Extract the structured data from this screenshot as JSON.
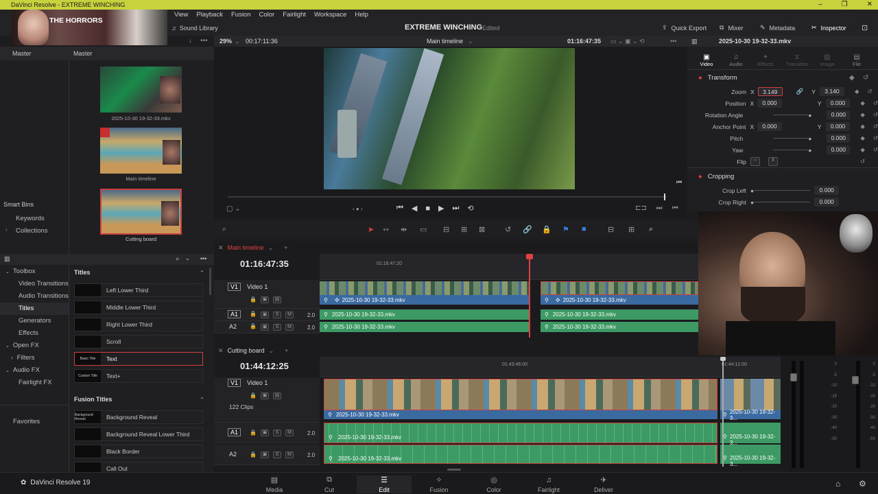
{
  "window": {
    "title": "DaVinci Resolve - EXTREME WINCHING"
  },
  "menu": {
    "items": [
      "View",
      "Playback",
      "Fusion",
      "Color",
      "Fairlight",
      "Workspace",
      "Help"
    ]
  },
  "webcam_overlay": {
    "title": "THE HORRORS"
  },
  "toolbar": {
    "sound_library": "Sound Library",
    "project_name": "EXTREME WINCHING",
    "edit_status": "Edited",
    "quick_export": "Quick Export",
    "mixer": "Mixer",
    "metadata": "Metadata",
    "inspector": "Inspector"
  },
  "media_pool": {
    "header_left": "Master",
    "header_right": "Master",
    "clips": [
      {
        "label": "2025-10-30 19-32-33.mkv"
      },
      {
        "label": "Main timeline"
      },
      {
        "label": "Cutting board"
      }
    ],
    "smart_bins": "Smart Bins",
    "bins": [
      "Keywords",
      "Collections"
    ]
  },
  "viewer": {
    "zoom": "29%",
    "duration": "00:17:11:36",
    "timeline_name": "Main timeline",
    "timecode": "01:16:47:35",
    "clip_name": "2025-10-30 19-32-33.mkv"
  },
  "effects": {
    "toolbox_items": [
      {
        "label": "Toolbox",
        "level": 0
      },
      {
        "label": "Video Transitions",
        "level": 1
      },
      {
        "label": "Audio Transitions",
        "level": 1
      },
      {
        "label": "Titles",
        "level": 1,
        "active": true
      },
      {
        "label": "Generators",
        "level": 1
      },
      {
        "label": "Effects",
        "level": 1
      },
      {
        "label": "Open FX",
        "level": 0
      },
      {
        "label": "Filters",
        "level": 1
      },
      {
        "label": "Audio FX",
        "level": 0
      },
      {
        "label": "Fairlight FX",
        "level": 1
      }
    ],
    "favorites": "Favorites",
    "titles_header": "Titles",
    "titles": [
      {
        "thumb": "",
        "name": "Left Lower Third"
      },
      {
        "thumb": "",
        "name": "Middle Lower Third"
      },
      {
        "thumb": "",
        "name": "Right Lower Third"
      },
      {
        "thumb": "",
        "name": "Scroll"
      },
      {
        "thumb": "Basic Title",
        "name": "Text"
      },
      {
        "thumb": "Custom Title",
        "name": "Text+"
      }
    ],
    "fusion_header": "Fusion Titles",
    "fusion_titles": [
      {
        "thumb": "Background Reveal",
        "name": "Background Reveal"
      },
      {
        "thumb": "",
        "name": "Background Reveal Lower Third"
      },
      {
        "thumb": "",
        "name": "Black Border"
      },
      {
        "thumb": "",
        "name": "Call Out"
      }
    ]
  },
  "inspector": {
    "tabs": [
      "Video",
      "Audio",
      "Effects",
      "Transition",
      "Image",
      "File"
    ],
    "transform_label": "Transform",
    "zoom": {
      "label": "Zoom",
      "x": "3.149",
      "y": "3.140"
    },
    "position": {
      "label": "Position",
      "x": "0.000",
      "y": "0.000"
    },
    "rotation": {
      "label": "Rotation Angle",
      "value": "0.000"
    },
    "anchor": {
      "label": "Anchor Point",
      "x": "0.000",
      "y": "0.000"
    },
    "pitch": {
      "label": "Pitch",
      "value": "0.000"
    },
    "yaw": {
      "label": "Yaw",
      "value": "0.000"
    },
    "flip": {
      "label": "Flip"
    },
    "cropping_label": "Cropping",
    "crop_left": {
      "label": "Crop Left",
      "value": "0.000"
    },
    "crop_right": {
      "label": "Crop Right",
      "value": "0.000"
    },
    "axis_x": "X",
    "axis_y": "Y"
  },
  "main_timeline": {
    "tab": "Main timeline",
    "timecode": "01:16:47:35",
    "ruler_mark": "01:16:47:20",
    "v1": {
      "badge": "V1",
      "name": "Video 1"
    },
    "a1": {
      "badge": "A1",
      "vol": "2.0"
    },
    "a2": {
      "badge": "A2",
      "vol": "2.0"
    },
    "clip": "2025-10-30 19-32-33.mkv"
  },
  "cutting_board": {
    "tab": "Cutting board",
    "timecode": "01:44:12:25",
    "ruler_mark_1": "01:43:46:00",
    "ruler_mark_2": "01:44:12:00",
    "v1": {
      "badge": "V1",
      "name": "Video 1"
    },
    "clip_count": "122 Clips",
    "a1": {
      "badge": "A1",
      "vol": "2.0"
    },
    "a2": {
      "badge": "A2",
      "vol": "2.0"
    },
    "clip": "2025-10-30 19-32-33.mkv",
    "clip_short": "2025-10-30 19-32-3..."
  },
  "meter_ticks": [
    "0",
    "-5",
    "-10",
    "-15",
    "-20",
    "-30",
    "-40",
    "-50"
  ],
  "pages": [
    "Media",
    "Cut",
    "Edit",
    "Fusion",
    "Color",
    "Fairlight",
    "Deliver"
  ],
  "active_page": "Edit",
  "brand": "DaVinci Resolve 19"
}
